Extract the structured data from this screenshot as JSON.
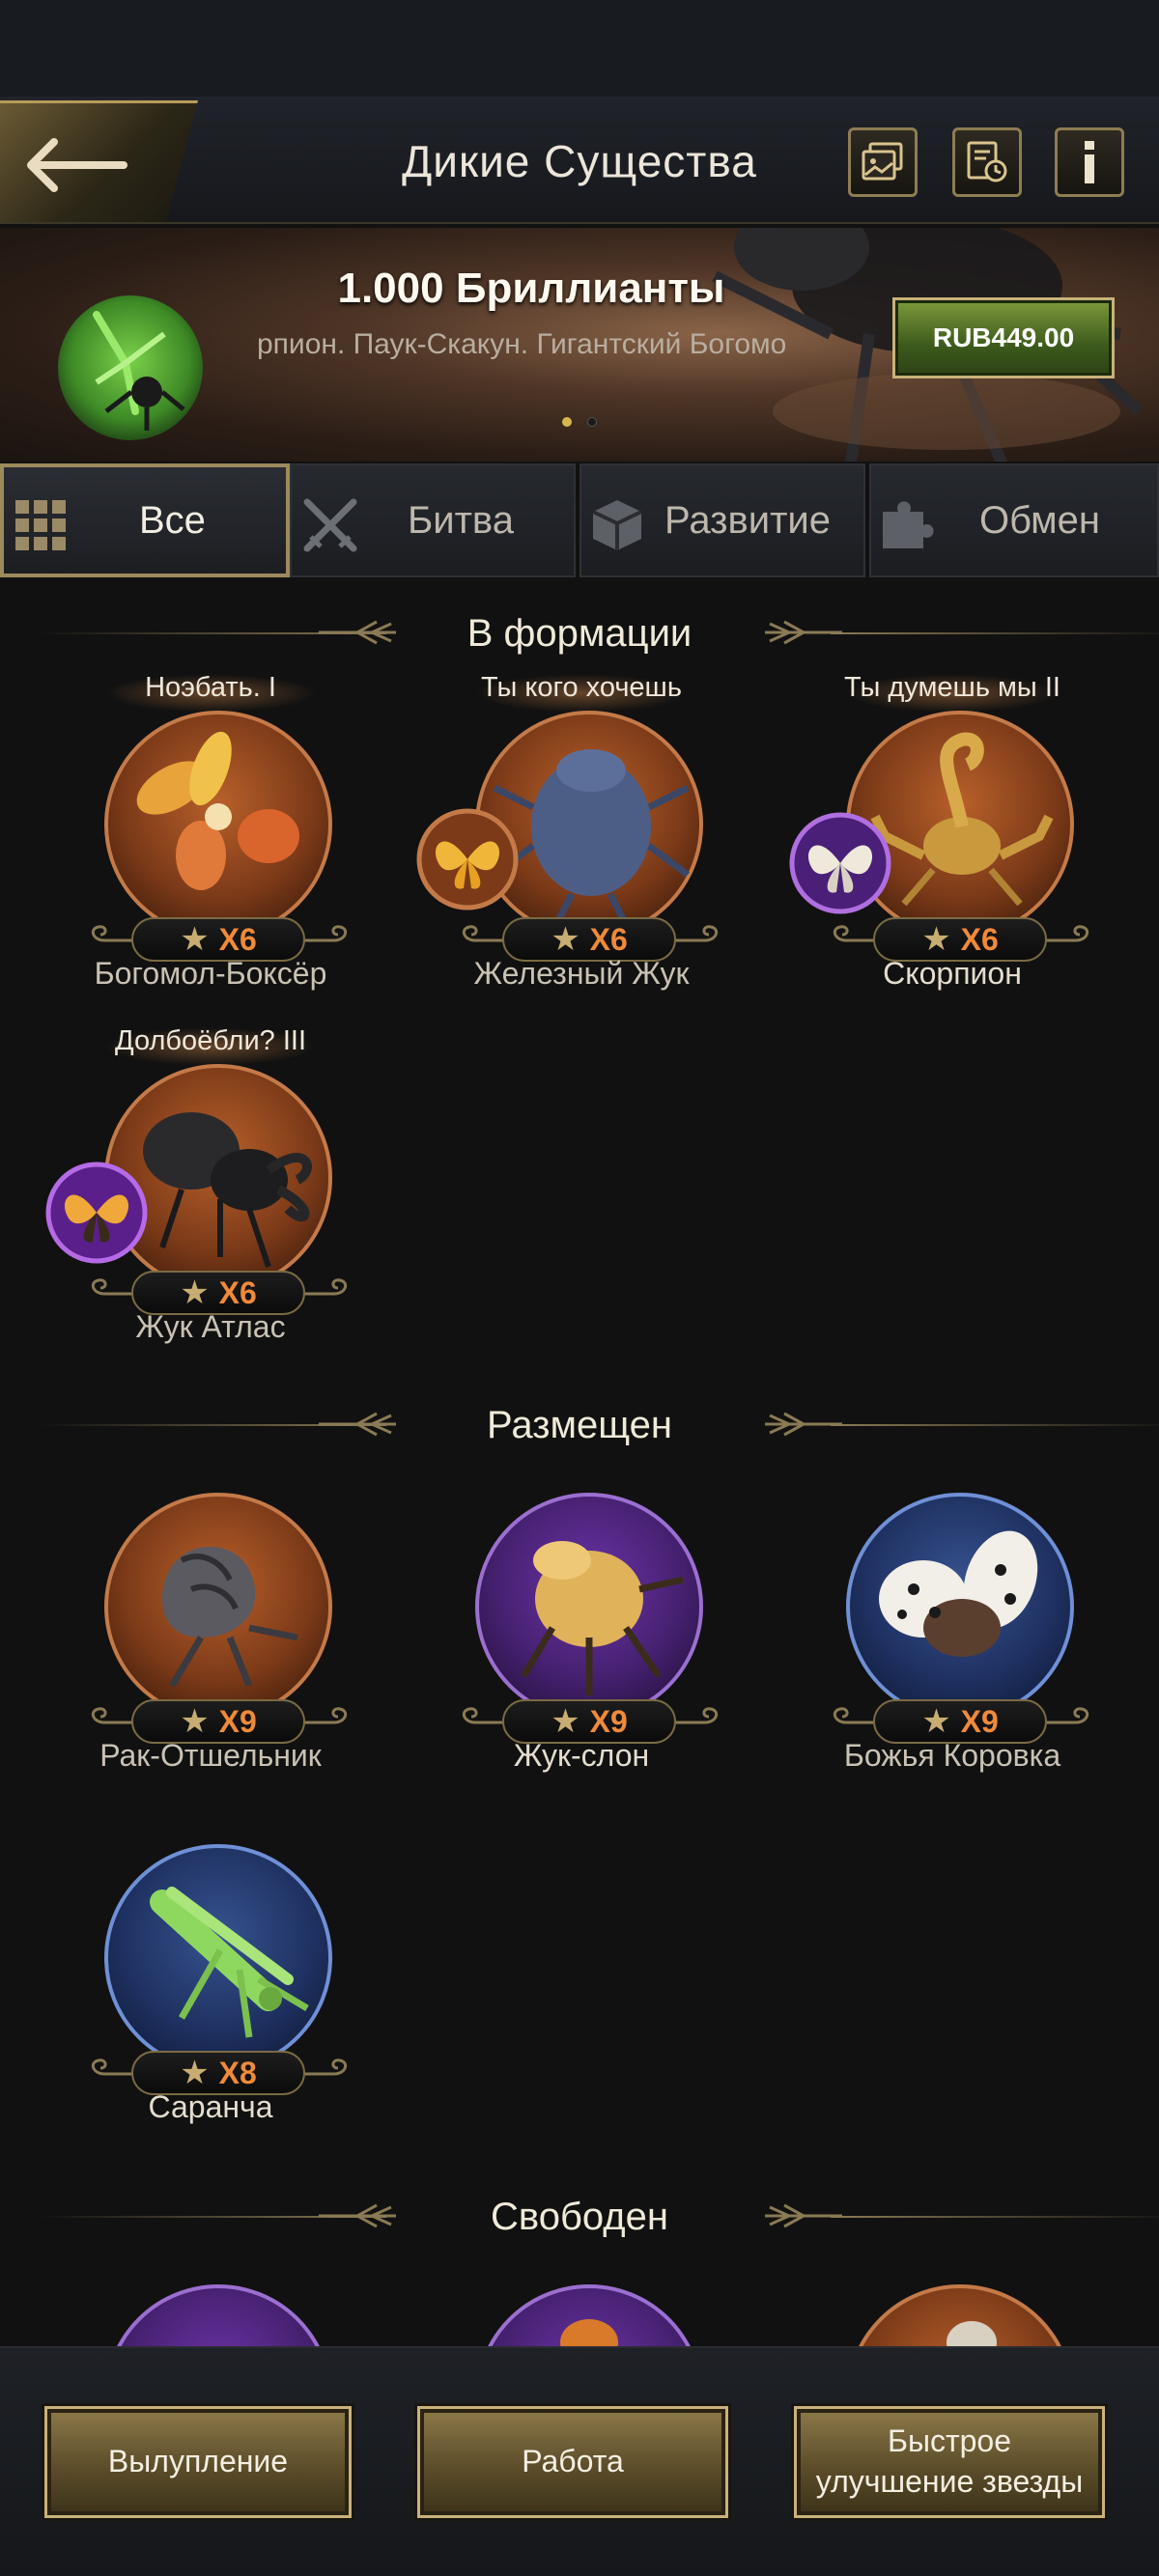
{
  "header": {
    "title": "Дикие Существа",
    "back_icon": "back-arrow-icon",
    "icons": [
      "gallery-icon",
      "history-icon",
      "info-icon"
    ]
  },
  "banner": {
    "title": "1.000 Бриллианты",
    "subtitle": "рпион. Паук-Скакун. Гигантский Богомо",
    "price": "RUB449.00",
    "pager_active": 0,
    "pager_count": 2
  },
  "tabs": [
    {
      "label": "Все",
      "icon": "grid-icon",
      "active": true
    },
    {
      "label": "Битва",
      "icon": "crossed-swords-icon",
      "active": false
    },
    {
      "label": "Развитие",
      "icon": "cube-icon",
      "active": false
    },
    {
      "label": "Обмен",
      "icon": "puzzle-icon",
      "active": false
    }
  ],
  "sections": {
    "formation": "В формации",
    "placed": "Размещен",
    "free": "Свободен"
  },
  "formation_cards": [
    {
      "tag": "Ноэбать. I",
      "name": "Богомол-Боксёр",
      "stars": "X6",
      "rarity": "bronze",
      "badge": null
    },
    {
      "tag": "Ты кого хочешь",
      "name": "Железный Жук",
      "stars": "X6",
      "rarity": "bronze",
      "badge": "bronze"
    },
    {
      "tag": "Ты думешь мы II",
      "name": "Скорпион",
      "stars": "X6",
      "rarity": "bronze",
      "badge": "purple"
    },
    {
      "tag": "Долбоёбли? III",
      "name": "Жук Атлас",
      "stars": "X6",
      "rarity": "bronze",
      "badge": "purple"
    }
  ],
  "placed_cards": [
    {
      "name": "Рак-Отшельник",
      "stars": "X9",
      "rarity": "bronze"
    },
    {
      "name": "Жук-слон",
      "stars": "X9",
      "rarity": "purple"
    },
    {
      "name": "Божья Коровка",
      "stars": "X9",
      "rarity": "blue"
    },
    {
      "name": "Саранча",
      "stars": "X8",
      "rarity": "blue"
    }
  ],
  "free_cards": [
    {
      "rarity": "purple"
    },
    {
      "rarity": "purple"
    },
    {
      "rarity": "bronze"
    }
  ],
  "bottom": {
    "hatch": "Вылупление",
    "work": "Работа",
    "quick_upgrade": "Быстрое улучшение звезды"
  }
}
